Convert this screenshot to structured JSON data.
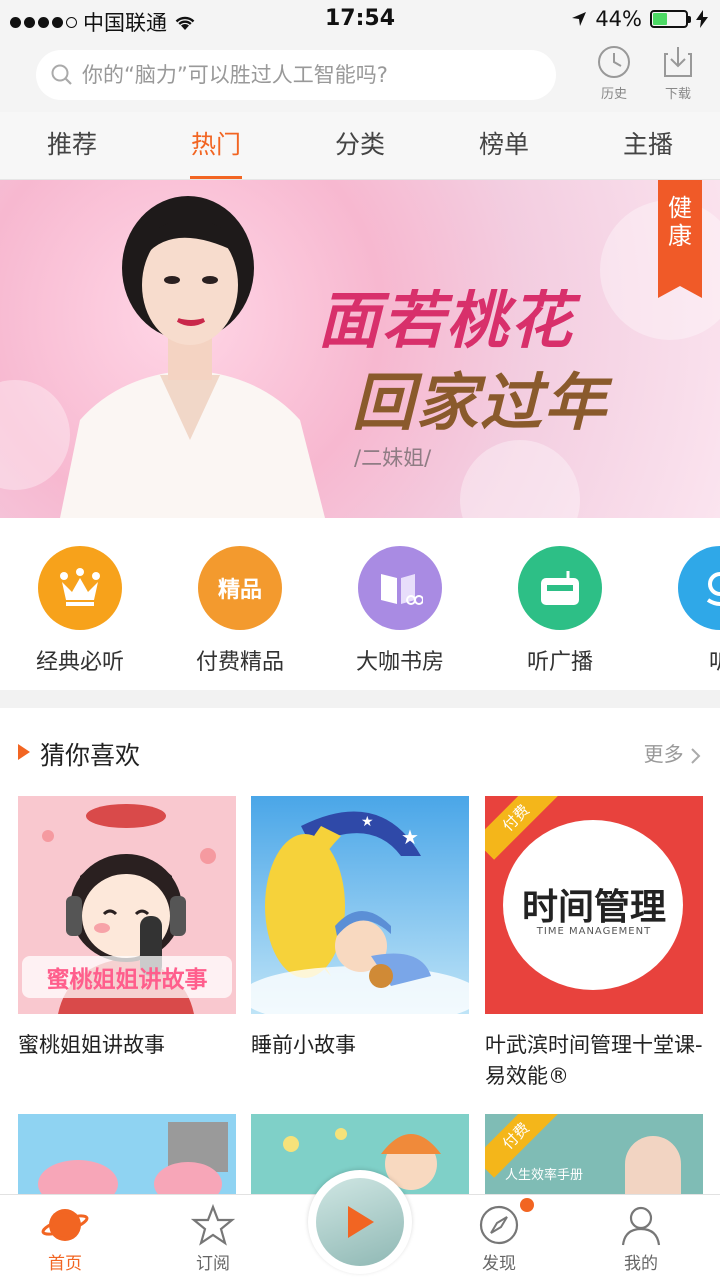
{
  "status_bar": {
    "carrier": "中国联通",
    "time": "17:54",
    "battery": "44%",
    "battery_level": 0.44,
    "icons": [
      "signal-dots-icon",
      "wifi-icon",
      "location-arrow-icon",
      "battery-icon",
      "charging-bolt-icon"
    ]
  },
  "search": {
    "placeholder": "你的“脑力”可以胜过人工智能吗?",
    "history_label": "历史",
    "download_label": "下载",
    "icons": [
      "search-icon",
      "clock-icon",
      "download-icon"
    ]
  },
  "tabs": [
    {
      "label": "推荐",
      "active": false
    },
    {
      "label": "热门",
      "active": true
    },
    {
      "label": "分类",
      "active": false
    },
    {
      "label": "榜单",
      "active": false
    },
    {
      "label": "主播",
      "active": false
    }
  ],
  "banner": {
    "headline1": "面若桃花",
    "headline2": "回家过年",
    "author": "/二妹姐/",
    "ribbon": "健康",
    "colors": {
      "headline1": "#d8306b",
      "headline2": "#8a5a2c",
      "ribbon": "#f05a28"
    }
  },
  "categories": [
    {
      "label": "经典必听",
      "icon": "crown-icon",
      "color": "#f7a21b"
    },
    {
      "label": "付费精品",
      "icon": "premium-icon",
      "color": "#f39a2e",
      "icon_text": "精品"
    },
    {
      "label": "大咖书房",
      "icon": "book-icon",
      "color": "#a98be3"
    },
    {
      "label": "听广播",
      "icon": "radio-icon",
      "color": "#2dbf86"
    },
    {
      "label": "听",
      "icon": "audio-icon",
      "color": "#2fa8e8"
    }
  ],
  "section": {
    "title": "猜你喜欢",
    "more": "更多"
  },
  "cards": [
    {
      "title": "蜜桃姐姐讲故事",
      "cover_text": "蜜桃姐姐讲故事",
      "paid": false
    },
    {
      "title": "睡前小故事",
      "paid": false
    },
    {
      "title": "叶武滨时间管理十堂课-易效能®",
      "cover_text": "时间管理",
      "cover_sub": "TIME MANAGEMENT",
      "paid": true,
      "paid_label": "付费"
    }
  ],
  "second_row": [
    {
      "paid": false
    },
    {
      "paid": false
    },
    {
      "paid": true,
      "paid_label": "付费",
      "cover_text": "人生效率手册"
    }
  ],
  "bottom_nav": [
    {
      "label": "首页",
      "icon": "home-planet-icon",
      "active": true
    },
    {
      "label": "订阅",
      "icon": "star-icon",
      "active": false
    },
    {
      "label": "发现",
      "icon": "compass-icon",
      "active": false
    },
    {
      "label": "我的",
      "icon": "user-icon",
      "active": false
    }
  ],
  "accent_color": "#f26522"
}
